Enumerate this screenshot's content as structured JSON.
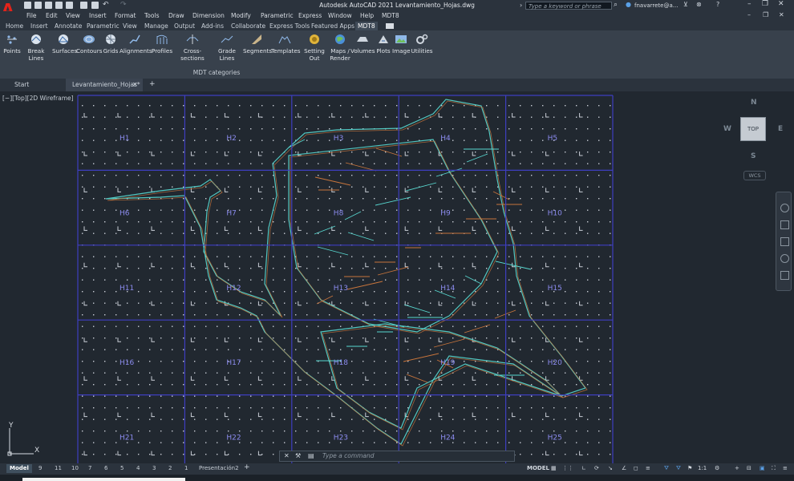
{
  "app": {
    "title": "Autodesk AutoCAD 2021    Levantamiento_Hojas.dwg",
    "logo": "A",
    "search_placeholder": "Type a keyword or phrase",
    "user": "fnavarrete@a..."
  },
  "menu": [
    "File",
    "Edit",
    "View",
    "Insert",
    "Format",
    "Tools",
    "Draw",
    "Dimension",
    "Modify",
    "Parametric",
    "Express",
    "Window",
    "Help",
    "MDT8"
  ],
  "ribbon_tabs": [
    "Home",
    "Insert",
    "Annotate",
    "Parametric",
    "View",
    "Manage",
    "Output",
    "Add-ins",
    "Collaborate",
    "Express Tools",
    "Featured Apps",
    "MDT8"
  ],
  "ribbon_active_tab": "MDT8",
  "ribbon_buttons": [
    "Points",
    "Break Lines",
    "Surfaces",
    "Contours",
    "Grids",
    "Alignments",
    "Profiles",
    "Cross-sections",
    "Grade Lines",
    "Segments",
    "Templates",
    "Setting Out",
    "Maps / Render",
    "Volumes",
    "Plots",
    "Image",
    "Utilities"
  ],
  "ribbon_panel_label": "MDT categories",
  "file_tabs": [
    "Start",
    "Levantamiento_Hojas*"
  ],
  "viewport_label": "[−][Top][2D Wireframe]",
  "viewcube": {
    "top": "TOP",
    "n": "N",
    "s": "S",
    "e": "E",
    "w": "W",
    "wcs": "WCS"
  },
  "sheets": [
    "H1",
    "H2",
    "H3",
    "H4",
    "H5",
    "H6",
    "H7",
    "H8",
    "H9",
    "H10",
    "H11",
    "H12",
    "H13",
    "H14",
    "H15",
    "H16",
    "H17",
    "H18",
    "H19",
    "H20",
    "H21",
    "H22",
    "H23",
    "H24",
    "H25"
  ],
  "ucs": {
    "x": "X",
    "y": "Y"
  },
  "command_placeholder": "Type a command",
  "layout_tabs": [
    "Model",
    "9",
    "11",
    "10",
    "7",
    "6",
    "5",
    "4",
    "3",
    "2",
    "1",
    "Presentación2"
  ],
  "status": {
    "model": "MODEL",
    "scale": "1:1"
  },
  "colors": {
    "background": "#212830",
    "grid_lines": "#3e3ec0",
    "contours_a": "#58d8d0",
    "contours_b": "#c8753c",
    "accent": "#e2231a"
  }
}
